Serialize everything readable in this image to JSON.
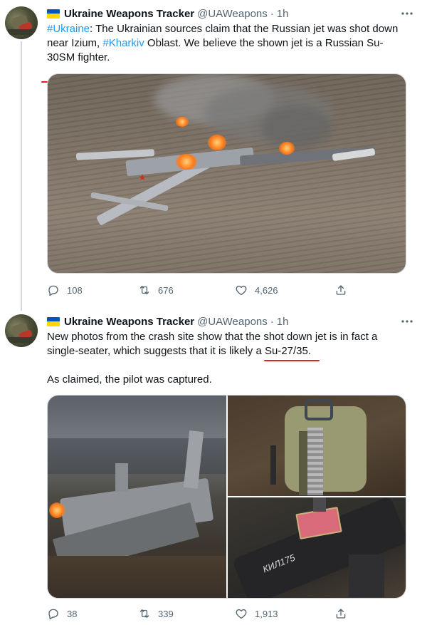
{
  "colors": {
    "accent": "#1d9bf0",
    "annotation": "#e0201b",
    "muted": "#536471"
  },
  "tweets": [
    {
      "display_name": "Ukraine Weapons Tracker",
      "handle": "@UAWeapons",
      "separator": "·",
      "time": "1h",
      "more_icon": "more-horizontal-icon",
      "text_parts": {
        "hashtag_1": "#Ukraine",
        "t1": ": The Ukrainian sources claim that the Russian jet was shot down near Izium, ",
        "hashtag_2": "#Kharkiv",
        "t2": " Oblast. We believe the shown jet is a Russian ",
        "highlight": "Su-30SM",
        "t3": " fighter."
      },
      "image_alt": "burning jet wreckage in a field",
      "replies": "108",
      "retweets": "676",
      "likes": "4,626"
    },
    {
      "display_name": "Ukraine Weapons Tracker",
      "handle": "@UAWeapons",
      "separator": "·",
      "time": "1h",
      "more_icon": "more-horizontal-icon",
      "text_parts": {
        "t1": "New photos from the crash site show that the shot down jet is in fact a single-seater, which suggests that it is likely a ",
        "highlight": "Su-27/35",
        "t2": ".",
        "p2": "As claimed, the pilot was captured."
      },
      "plate_text": "КИЛ175",
      "replies": "38",
      "retweets": "339",
      "likes": "1,913"
    }
  ]
}
